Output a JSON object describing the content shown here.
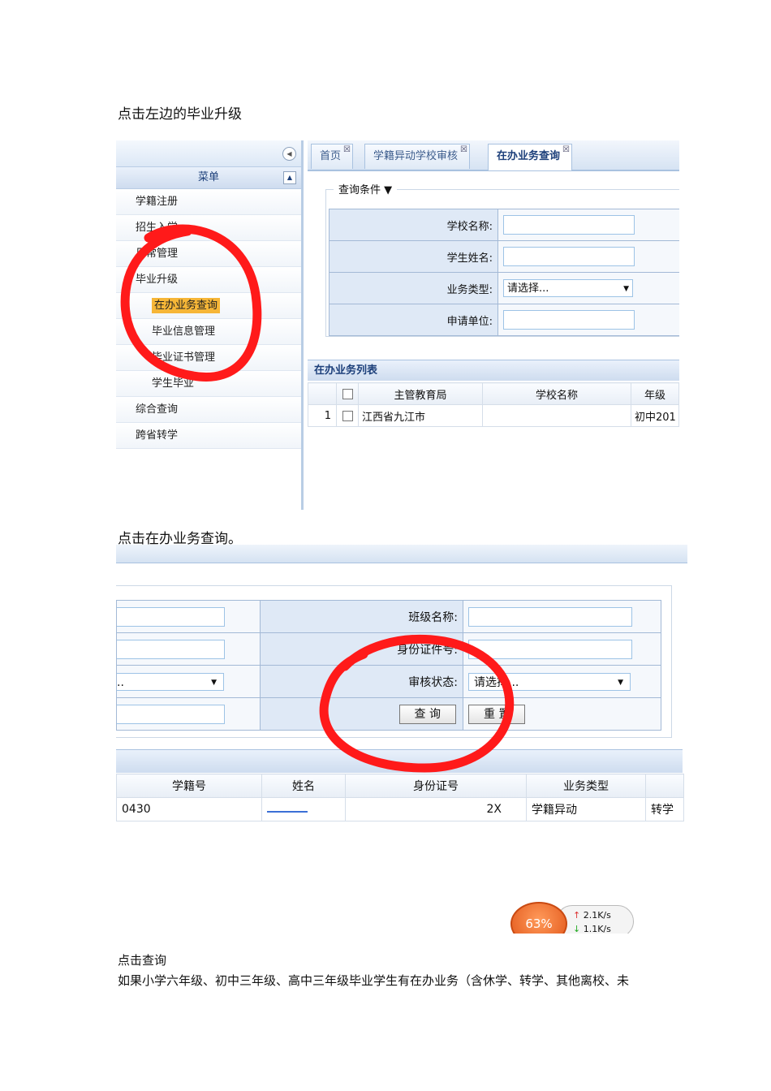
{
  "caption1": "点击左边的毕业升级",
  "caption2": "点击在办业务查询。",
  "caption3": "点击查询",
  "caption4": "如果小学六年级、初中三年级、高中三年级毕业学生有在办业务（含休学、转学、其他离校、未",
  "shot1": {
    "menu_title": "菜单",
    "menu": [
      {
        "label": "学籍注册"
      },
      {
        "label": "招生入学"
      },
      {
        "label": "日常管理"
      },
      {
        "label": "毕业升级"
      },
      {
        "label": "在办业务查询"
      },
      {
        "label": "毕业信息管理"
      },
      {
        "label": "毕业证书管理"
      },
      {
        "label": "学生毕业"
      },
      {
        "label": "综合查询"
      },
      {
        "label": "跨省转学"
      }
    ],
    "tabs": [
      "首页",
      "学籍异动学校审核",
      "在办业务查询"
    ],
    "legend": "查询条件",
    "fields": {
      "school_name": "学校名称:",
      "student_name": "学生姓名:",
      "biz_type": "业务类型:",
      "biz_type_value": "请选择...",
      "apply_unit": "申请单位:"
    },
    "list_title": "在办业务列表",
    "columns": [
      "主管教育局",
      "学校名称",
      "年级"
    ],
    "row": {
      "index": "1",
      "bureau": "江西省九江市",
      "grade": "初中201"
    }
  },
  "shot2": {
    "fields": {
      "class_name": "班级名称:",
      "id_number": "身份证件号:",
      "review_status": "审核状态:",
      "review_status_value": "请选择...",
      "left_select_value": ".."
    },
    "buttons": {
      "query": "查 询",
      "reset": "重 置"
    },
    "columns": [
      "学籍号",
      "姓名",
      "身份证号",
      "业务类型"
    ],
    "row": {
      "student_no": "0430",
      "id_tail": "2X",
      "biz_type": "学籍异动",
      "extra": "转学"
    },
    "speed": {
      "percent": "63%",
      "up": "2.1K/s",
      "down": "1.1K/s"
    }
  }
}
